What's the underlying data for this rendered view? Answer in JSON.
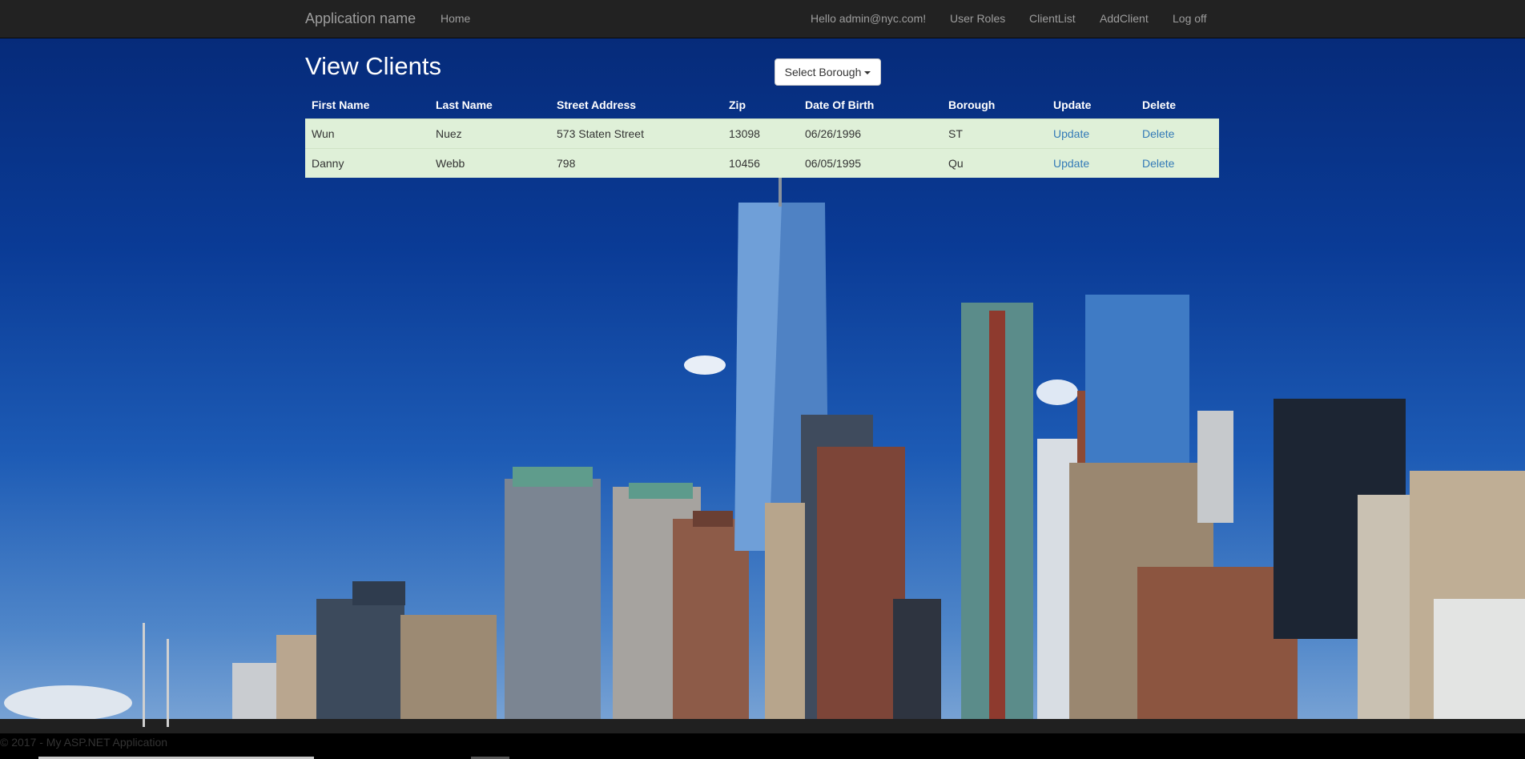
{
  "navbar": {
    "brand": "Application name",
    "home": "Home",
    "greeting": "Hello admin@nyc.com!",
    "user_roles": "User Roles",
    "client_list": "ClientList",
    "add_client": "AddClient",
    "log_off": "Log off"
  },
  "main": {
    "title": "View Clients",
    "borough_dropdown": "Select Borough"
  },
  "table": {
    "headers": [
      "First Name",
      "Last Name",
      "Street Address",
      "Zip",
      "Date Of Birth",
      "Borough",
      "Update",
      "Delete"
    ],
    "rows": [
      {
        "first_name": "Wun",
        "last_name": "Nuez",
        "street": "573 Staten Street",
        "zip": "13098",
        "dob": "06/26/1996",
        "borough": "ST",
        "update": "Update",
        "delete": "Delete"
      },
      {
        "first_name": "Danny",
        "last_name": "Webb",
        "street": "798",
        "zip": "10456",
        "dob": "06/05/1995",
        "borough": "Qu",
        "update": "Update",
        "delete": "Delete"
      }
    ]
  },
  "footer": {
    "copyright": "© 2017 - My ASP.NET Application"
  },
  "colors": {
    "navbar_bg": "#222222",
    "nav_text": "#9d9d9d",
    "row_success_bg": "#dff0d8",
    "link": "#337ab7"
  },
  "background_image": "new-york-city-skyline"
}
